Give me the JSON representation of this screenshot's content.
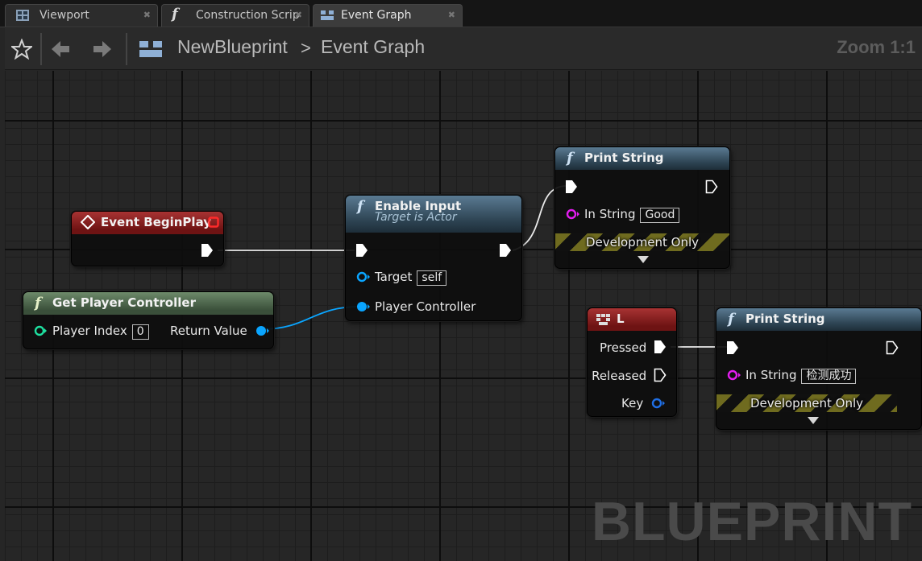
{
  "tabs": [
    {
      "label": "Viewport",
      "icon": "viewport-icon"
    },
    {
      "label": "Construction Scrip",
      "icon": "function-icon"
    },
    {
      "label": "Event Graph",
      "icon": "event-graph-icon"
    }
  ],
  "toolbar": {
    "breadcrumb_root": "NewBlueprint",
    "breadcrumb_separator": ">",
    "breadcrumb_current": "Event Graph",
    "zoom": "Zoom 1:1"
  },
  "watermark": "BLUEPRINT",
  "colors": {
    "exec_wire": "#ffffff",
    "object_pin": "#0aa5ff",
    "string_pin": "#e41df0",
    "int_pin": "#1ee0a0",
    "event_header": "#8a2222",
    "function_header": "#3a5568",
    "pure_header": "#4a6a4a"
  },
  "nodes": {
    "event_begin_play": {
      "title": "Event BeginPlay"
    },
    "get_player_controller": {
      "title": "Get Player Controller",
      "player_index_label": "Player Index",
      "player_index_value": "0",
      "return_label": "Return Value"
    },
    "enable_input": {
      "title": "Enable Input",
      "subtitle": "Target is Actor",
      "target_label": "Target",
      "target_value": "self",
      "player_controller_label": "Player Controller"
    },
    "print_string_1": {
      "title": "Print String",
      "in_string_label": "In String",
      "in_string_value": "Good",
      "dev_label": "Development Only"
    },
    "key_l": {
      "title": "L",
      "pressed_label": "Pressed",
      "released_label": "Released",
      "key_label": "Key"
    },
    "print_string_2": {
      "title": "Print String",
      "in_string_label": "In String",
      "in_string_value": "检测成功",
      "dev_label": "Development Only"
    }
  }
}
